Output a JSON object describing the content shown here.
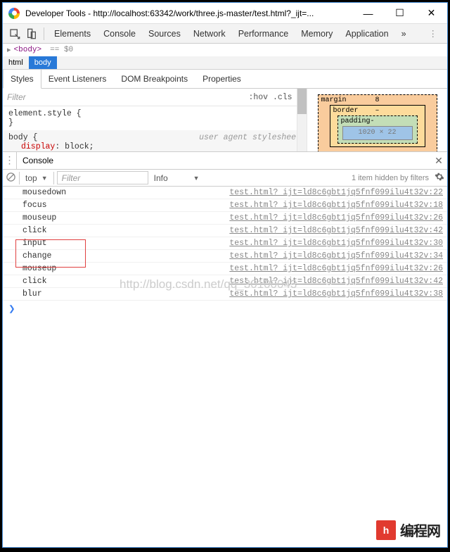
{
  "titlebar": {
    "text": "Developer Tools - http://localhost:63342/work/three.js-master/test.html?_ijt=...",
    "controls": {
      "min": "—",
      "max": "☐",
      "close": "✕"
    }
  },
  "tabs": {
    "items": [
      "Elements",
      "Console",
      "Sources",
      "Network",
      "Performance",
      "Memory",
      "Application"
    ],
    "overflow": "»",
    "menu": "⋮"
  },
  "crumb": {
    "arrow": "▸",
    "tag": "<body>",
    "eq": "== $0"
  },
  "path": {
    "items": [
      "html",
      "body"
    ],
    "selected": 1
  },
  "subtabs": [
    "Styles",
    "Event Listeners",
    "DOM Breakpoints",
    "Properties"
  ],
  "stylesFilter": {
    "placeholder": "Filter",
    "end": ":hov  .cls",
    "plus": "+"
  },
  "rules": [
    {
      "selector": "element.style {",
      "close": "}",
      "uas": ""
    },
    {
      "selector": "body {",
      "close": "",
      "uas": "user agent stylesheet",
      "prop": "display",
      "val": "block",
      "after": ";"
    }
  ],
  "box": {
    "margin": "margin",
    "m_num": "8",
    "border": "border",
    "b_num": "–",
    "padding": "padding-",
    "content": "1020 × 22"
  },
  "consoleHeader": {
    "dots": "⋮",
    "label": "Console",
    "close": "✕"
  },
  "consoleFilters": {
    "top": "top",
    "tri": "▼",
    "filterPlaceholder": "Filter",
    "info": "Info",
    "infoTri": "▼",
    "right": "1 item hidden by filters"
  },
  "logs": [
    {
      "msg": "mousedown",
      "src": "test.html? ijt=ld8c6gbt1jq5fnf099ilu4t32v:22"
    },
    {
      "msg": "focus",
      "src": "test.html? ijt=ld8c6gbt1jq5fnf099ilu4t32v:18"
    },
    {
      "msg": "mouseup",
      "src": "test.html? ijt=ld8c6gbt1jq5fnf099ilu4t32v:26"
    },
    {
      "msg": "click",
      "src": "test.html? ijt=ld8c6gbt1jq5fnf099ilu4t32v:42"
    },
    {
      "msg": "input",
      "src": "test.html? ijt=ld8c6gbt1jq5fnf099ilu4t32v:30"
    },
    {
      "msg": "change",
      "src": "test.html? ijt=ld8c6gbt1jq5fnf099ilu4t32v:34"
    },
    {
      "msg": "mouseup",
      "src": "test.html? ijt=ld8c6gbt1jq5fnf099ilu4t32v:26"
    },
    {
      "msg": "click",
      "src": "test.html? ijt=ld8c6gbt1jq5fnf099ilu4t32v:42"
    },
    {
      "msg": "blur",
      "src": "test.html? ijt=ld8c6gbt1jq5fnf099ilu4t32v:38"
    }
  ],
  "prompt": "❯",
  "watermark1": "http://blog.csdn.net/qq_30100043",
  "watermark2": {
    "logo": "h",
    "text": "编程网"
  }
}
